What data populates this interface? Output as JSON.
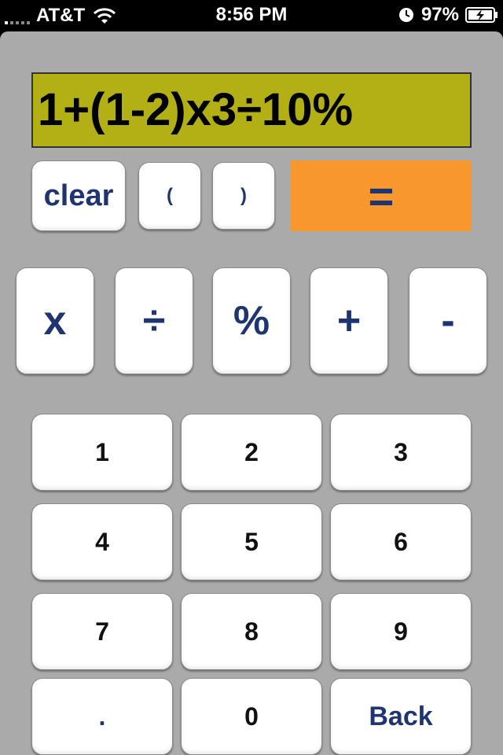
{
  "status_bar": {
    "carrier": "AT&T",
    "time": "8:56 PM",
    "battery": "97%",
    "icons": [
      "signal-icon",
      "wifi-icon",
      "clock-icon",
      "battery-charging-icon"
    ]
  },
  "display": {
    "expression": "1+(1-2)x3÷10%"
  },
  "controls": {
    "clear": "clear",
    "open_paren": "(",
    "close_paren": ")",
    "equals": "="
  },
  "operators": {
    "multiply": "x",
    "divide": "÷",
    "percent": "%",
    "plus": "+",
    "minus": "-"
  },
  "keypad": {
    "k1": "1",
    "k2": "2",
    "k3": "3",
    "k4": "4",
    "k5": "5",
    "k6": "6",
    "k7": "7",
    "k8": "8",
    "k9": "9",
    "dot": ".",
    "k0": "0",
    "back": "Back"
  },
  "colors": {
    "display_bg": "#b2b014",
    "equals_bg": "#f7972d",
    "app_bg": "#aaaaaa",
    "label_blue": "#1f3571"
  }
}
